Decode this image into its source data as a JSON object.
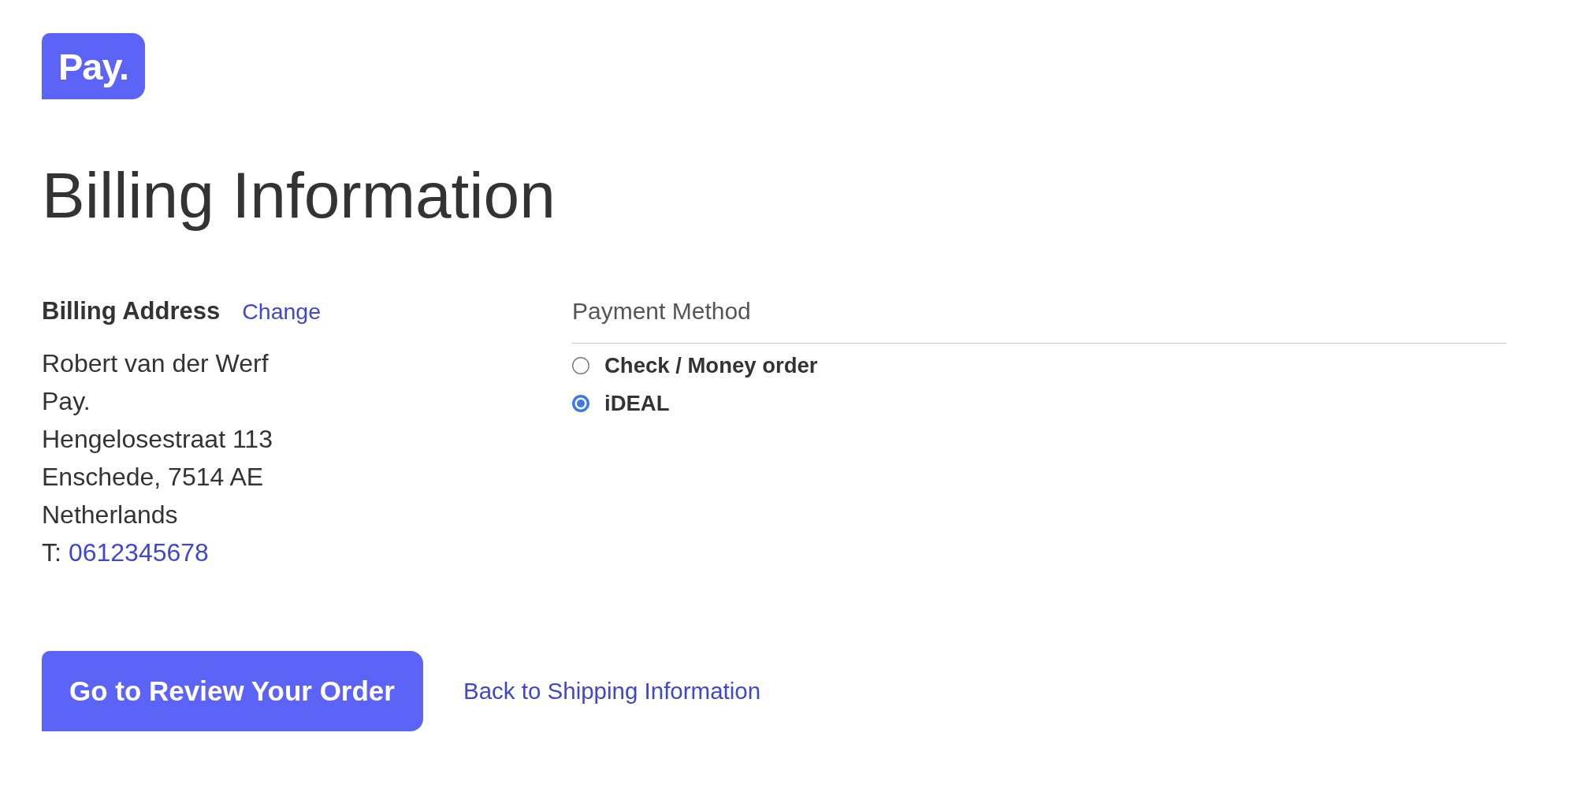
{
  "logo": {
    "text": "Pay."
  },
  "heading": "Billing Information",
  "billing_address": {
    "title": "Billing Address",
    "change_link": "Change",
    "lines": [
      "Robert van der Werf",
      "Pay.",
      "Hengelosestraat 113",
      "Enschede, 7514 AE",
      "Netherlands"
    ],
    "phone_label": "T:",
    "phone": "0612345678"
  },
  "payment_method": {
    "title": "Payment Method",
    "options": [
      {
        "label": "Check / Money order",
        "selected": false
      },
      {
        "label": "iDEAL",
        "selected": true
      }
    ]
  },
  "actions": {
    "primary_button": "Go to Review Your Order",
    "back_link": "Back to Shipping Information"
  }
}
